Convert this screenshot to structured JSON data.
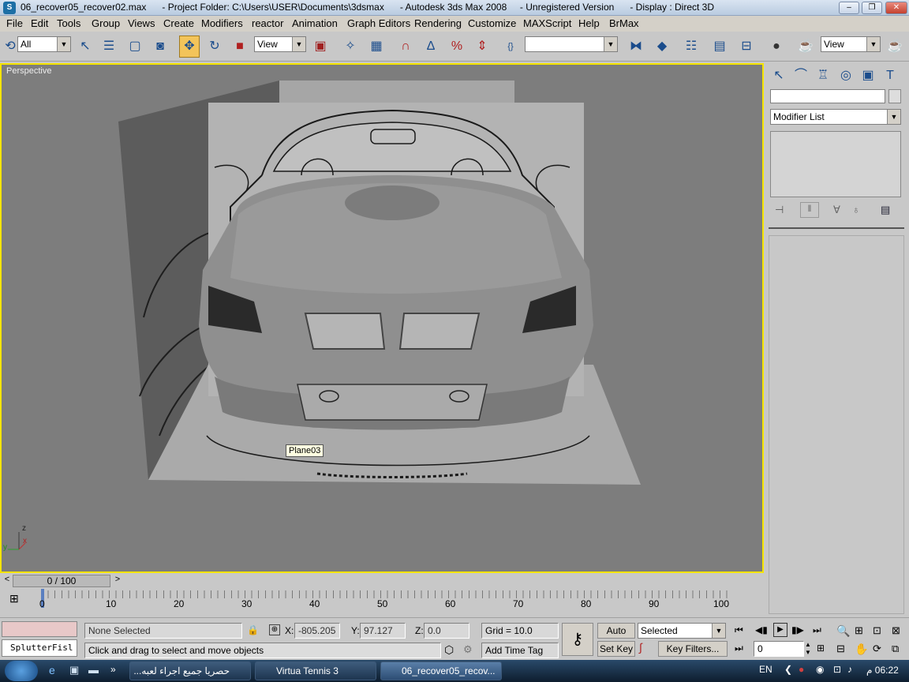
{
  "titlebar": {
    "title": "06_recover05_recover02.max      - Project Folder: C:\\Users\\USER\\Documents\\3dsmax      - Autodesk 3ds Max 2008     - Unregistered Version      - Display : Direct 3D",
    "minimize": "–",
    "maximize": "❐",
    "close": "✕"
  },
  "menubar": [
    "File",
    "Edit",
    "Tools",
    "Group",
    "Views",
    "Create",
    "Modifiers",
    "reactor",
    "Animation",
    "Graph Editors",
    "Rendering",
    "Customize",
    "MAXScript",
    "Help",
    "BrMax"
  ],
  "toolbar": {
    "selection_filter": "All",
    "ref_coord": "View",
    "named_selection": "",
    "view_right": "View"
  },
  "viewport": {
    "label": "Perspective",
    "tooltip": "Plane03",
    "axis_z": "z",
    "axis_x": "x",
    "axis_y": "y"
  },
  "command_panel": {
    "name_field": "",
    "modifier_list": "Modifier List"
  },
  "timeline": {
    "frame_display": "0 / 100",
    "ticks": [
      "0",
      "10",
      "20",
      "30",
      "40",
      "50",
      "60",
      "70",
      "80",
      "90",
      "100"
    ]
  },
  "status": {
    "script_listener": "SplutterFisl",
    "selection": "None Selected",
    "prompt": "Click and drag to select and move objects",
    "x_label": "X:",
    "x_value": "-805.205",
    "y_label": "Y:",
    "y_value": "97.127",
    "z_label": "Z:",
    "z_value": "0.0",
    "grid": "Grid = 10.0",
    "add_time_tag": "Add Time Tag",
    "auto_key": "Auto Key",
    "set_key": "Set Key",
    "key_mode": "Selected",
    "key_filters": "Key Filters...",
    "current_frame": "0"
  },
  "taskbar": {
    "tasks": [
      "حصريا جميع اجراء لعبه...",
      "Virtua Tennis 3",
      "06_recover05_recov..."
    ],
    "language": "EN",
    "clock": "06:22 م"
  }
}
